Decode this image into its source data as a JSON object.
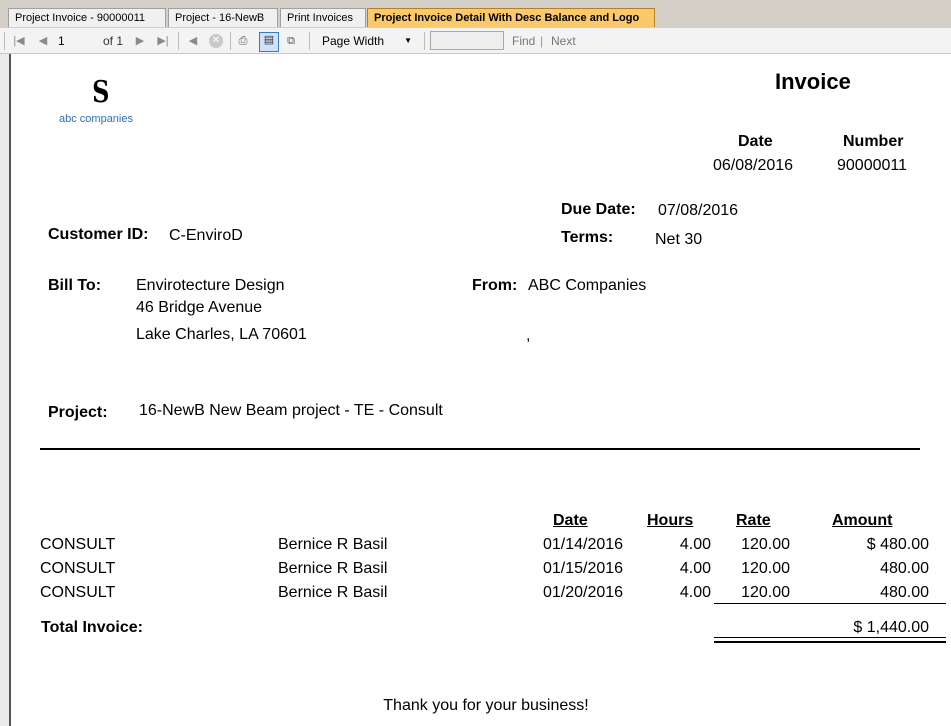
{
  "tabs": [
    {
      "label": "Project Invoice - 90000011",
      "active": false
    },
    {
      "label": "Project - 16-NewB",
      "active": false
    },
    {
      "label": "Print Invoices",
      "active": false
    },
    {
      "label": "Project Invoice Detail With Desc Balance and Logo",
      "active": true
    }
  ],
  "toolbar": {
    "page_current": "1",
    "page_of": "of 1",
    "zoom": "Page Width",
    "find_label": "Find",
    "next_label": "Next",
    "find_value": ""
  },
  "logo": {
    "mark": "S",
    "text": "abc companies"
  },
  "invoice": {
    "title": "Invoice",
    "date_label": "Date",
    "number_label": "Number",
    "date_value": "06/08/2016",
    "number_value": "90000011",
    "due_date_label": "Due Date:",
    "due_date_value": "07/08/2016",
    "terms_label": "Terms:",
    "terms_value": "Net 30",
    "customer_id_label": "Customer ID:",
    "customer_id_value": "C-EnviroD",
    "bill_to_label": "Bill To:",
    "bill_to": [
      "Envirotecture Design",
      "46 Bridge Avenue",
      "Lake Charles, LA  70601"
    ],
    "from_label": "From:",
    "from_name": "ABC Companies",
    "from_line2": ",",
    "project_label": "Project:",
    "project_value": "16-NewB New Beam project - TE - Consult",
    "columns": {
      "date": "Date",
      "hours": "Hours",
      "rate": "Rate",
      "amount": "Amount"
    },
    "rows": [
      {
        "code": "CONSULT",
        "name": "Bernice R Basil",
        "date": "01/14/2016",
        "hours": "4.00",
        "rate": "120.00",
        "amount": "$ 480.00"
      },
      {
        "code": "CONSULT",
        "name": "Bernice R Basil",
        "date": "01/15/2016",
        "hours": "4.00",
        "rate": "120.00",
        "amount": "480.00"
      },
      {
        "code": "CONSULT",
        "name": "Bernice R Basil",
        "date": "01/20/2016",
        "hours": "4.00",
        "rate": "120.00",
        "amount": "480.00"
      }
    ],
    "total_label": "Total Invoice:",
    "total_value": "$ 1,440.00",
    "thank_you": "Thank you for your business!"
  },
  "colors": {
    "active_tab": "#fbc96a",
    "logo_text": "#2f6fb5"
  }
}
